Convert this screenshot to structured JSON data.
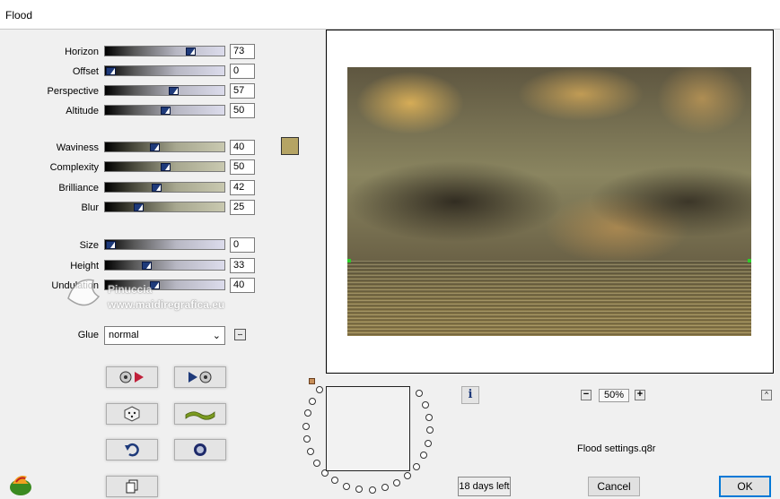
{
  "window": {
    "title": "Flood"
  },
  "params_group1": [
    {
      "label": "Horizon",
      "value": "73",
      "level": 0.73
    },
    {
      "label": "Offset",
      "value": "0",
      "level": 0.0
    },
    {
      "label": "Perspective",
      "value": "57",
      "level": 0.57
    },
    {
      "label": "Altitude",
      "value": "50",
      "level": 0.5
    }
  ],
  "params_group2": [
    {
      "label": "Waviness",
      "value": "40",
      "level": 0.4
    },
    {
      "label": "Complexity",
      "value": "50",
      "level": 0.5
    },
    {
      "label": "Brilliance",
      "value": "42",
      "level": 0.42
    },
    {
      "label": "Blur",
      "value": "25",
      "level": 0.25
    }
  ],
  "params_group3": [
    {
      "label": "Size",
      "value": "0",
      "level": 0.0
    },
    {
      "label": "Height",
      "value": "33",
      "level": 0.33
    },
    {
      "label": "Undulation",
      "value": "40",
      "level": 0.4
    }
  ],
  "color_swatch": "#b5a464",
  "glue": {
    "label": "Glue",
    "value": "normal"
  },
  "watermark": {
    "name": "Pinuccia",
    "url": "www.maidiregrafica.eu"
  },
  "buttons": {
    "load_preset": "load-preset-icon",
    "save_preset": "save-preset-icon",
    "randomize": "dice-icon",
    "reset_wave": "wave-icon",
    "undo": "undo-icon",
    "circle": "circle-icon",
    "copy": "copy-icon"
  },
  "zoom": {
    "value": "50%",
    "minus": "−",
    "plus": "+"
  },
  "info_label": "i",
  "up_label": "^",
  "settings_file": "Flood settings.q8r",
  "trial": "18 days left",
  "cancel_label": "Cancel",
  "ok_label": "OK"
}
